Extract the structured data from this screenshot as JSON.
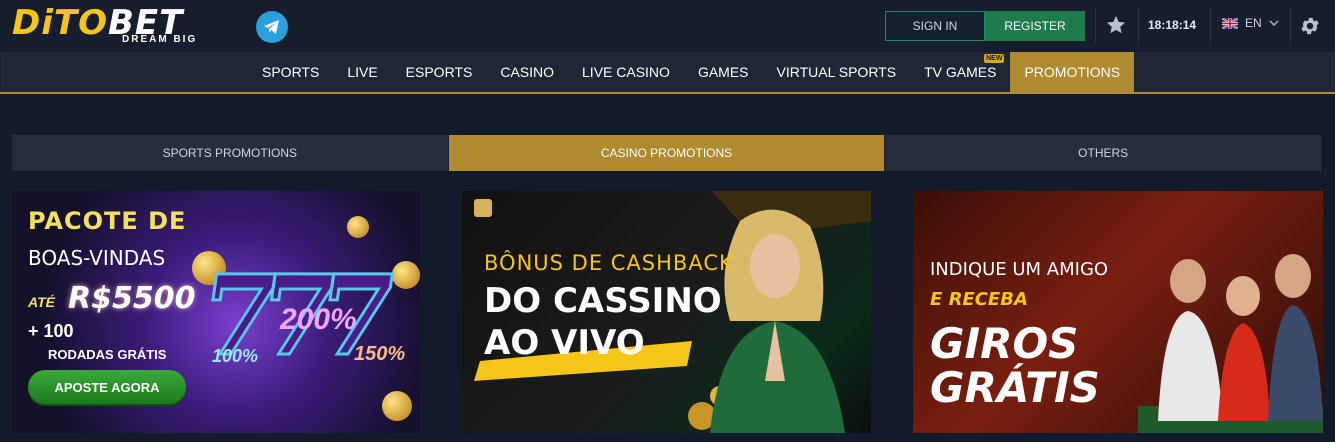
{
  "header": {
    "logo_prefix": "DiTO",
    "logo_suffix": "BET",
    "logo_tagline": "DREAM BIG",
    "sign_in_label": "SIGN IN",
    "register_label": "REGISTER",
    "clock": "18:18:14",
    "language": "EN"
  },
  "nav": {
    "items": [
      {
        "label": "SPORTS"
      },
      {
        "label": "LIVE"
      },
      {
        "label": "ESPORTS"
      },
      {
        "label": "CASINO"
      },
      {
        "label": "LIVE CASINO"
      },
      {
        "label": "GAMES"
      },
      {
        "label": "VIRTUAL SPORTS"
      },
      {
        "label": "TV GAMES",
        "badge": "NEW"
      },
      {
        "label": "PROMOTIONS",
        "active": true
      }
    ]
  },
  "promo_tabs": {
    "items": [
      {
        "label": "SPORTS PROMOTIONS"
      },
      {
        "label": "CASINO PROMOTIONS",
        "active": true
      },
      {
        "label": "OTHERS"
      }
    ]
  },
  "banners": {
    "welcome": {
      "line1": "PACOTE DE",
      "line2": "BOAS-VINDAS",
      "ate": "ATÉ",
      "amount": "R$5500",
      "plus": "+ 100",
      "spins": "RODADAS GRÁTIS",
      "cta": "APOSTE AGORA",
      "pct_left": "100%",
      "pct_mid": "200%",
      "pct_right": "150%"
    },
    "cashback": {
      "line1": "BÔNUS DE CASHBACK",
      "line2": "DO CASSINO",
      "line3": "AO VIVO"
    },
    "referral": {
      "line1": "INDIQUE UM AMIGO",
      "line2": "E RECEBA",
      "line3": "GIROS",
      "line4": "GRÁTIS"
    }
  },
  "colors": {
    "accent_gold": "#b08a2e",
    "register_green": "#1f7a4c",
    "background": "#131a2a"
  }
}
